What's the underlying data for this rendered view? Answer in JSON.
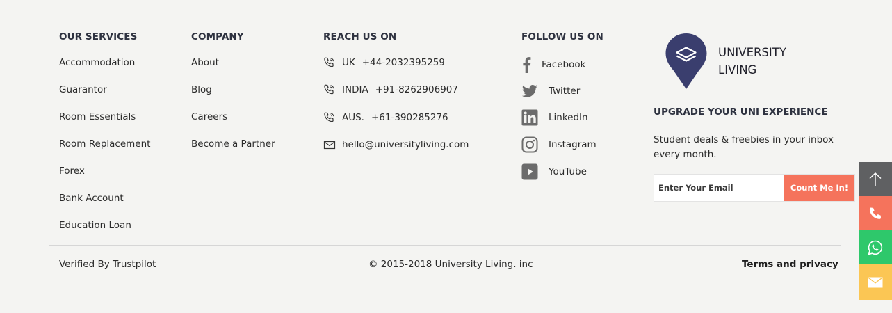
{
  "services": {
    "heading": "OUR SERVICES",
    "items": [
      "Accommodation",
      "Guarantor",
      "Room Essentials",
      "Room Replacement",
      "Forex",
      "Bank Account",
      "Education Loan"
    ]
  },
  "company": {
    "heading": "COMPANY",
    "items": [
      "About",
      "Blog",
      "Careers",
      "Become a Partner"
    ]
  },
  "reach": {
    "heading": "REACH US ON",
    "phones": [
      {
        "country": "UK",
        "number": "+44-2032395259",
        "icon": "phone-icon"
      },
      {
        "country": "INDIA",
        "number": "+91-8262906907",
        "icon": "phone-icon"
      },
      {
        "country": "AUS.",
        "number": "+61-390285276",
        "icon": "phone-icon"
      }
    ],
    "email": {
      "value": "hello@universityliving.com",
      "icon": "mail-icon"
    }
  },
  "follow": {
    "heading": "FOLLOW US ON",
    "items": [
      {
        "label": "Facebook",
        "icon": "facebook-icon"
      },
      {
        "label": "Twitter",
        "icon": "twitter-icon"
      },
      {
        "label": "LinkedIn",
        "icon": "linkedin-icon"
      },
      {
        "label": "Instagram",
        "icon": "instagram-icon"
      },
      {
        "label": "YouTube",
        "icon": "youtube-icon"
      }
    ]
  },
  "brand": {
    "line1": "UNIVERSITY",
    "line2": "LIVING",
    "logo_icon": "university-living-logo",
    "logo_color": "#3a3e6e"
  },
  "newsletter": {
    "title": "UPGRADE YOUR UNI EXPERIENCE",
    "text": "Student deals & freebies in your inbox every month.",
    "placeholder": "Enter Your Email",
    "button_label": "Count Me In!",
    "button_color": "#f5735c"
  },
  "footer": {
    "verified": "Verified By Trustpilot",
    "copyright": "© 2015-2018 University Living. inc",
    "terms": "Terms and privacy"
  },
  "floating": [
    {
      "icon": "arrow-up-icon",
      "color": "#5f6062"
    },
    {
      "icon": "phone-icon",
      "color": "#f5735c"
    },
    {
      "icon": "whatsapp-icon",
      "color": "#2ec86b"
    },
    {
      "icon": "mail-icon",
      "color": "#fbc654"
    }
  ]
}
